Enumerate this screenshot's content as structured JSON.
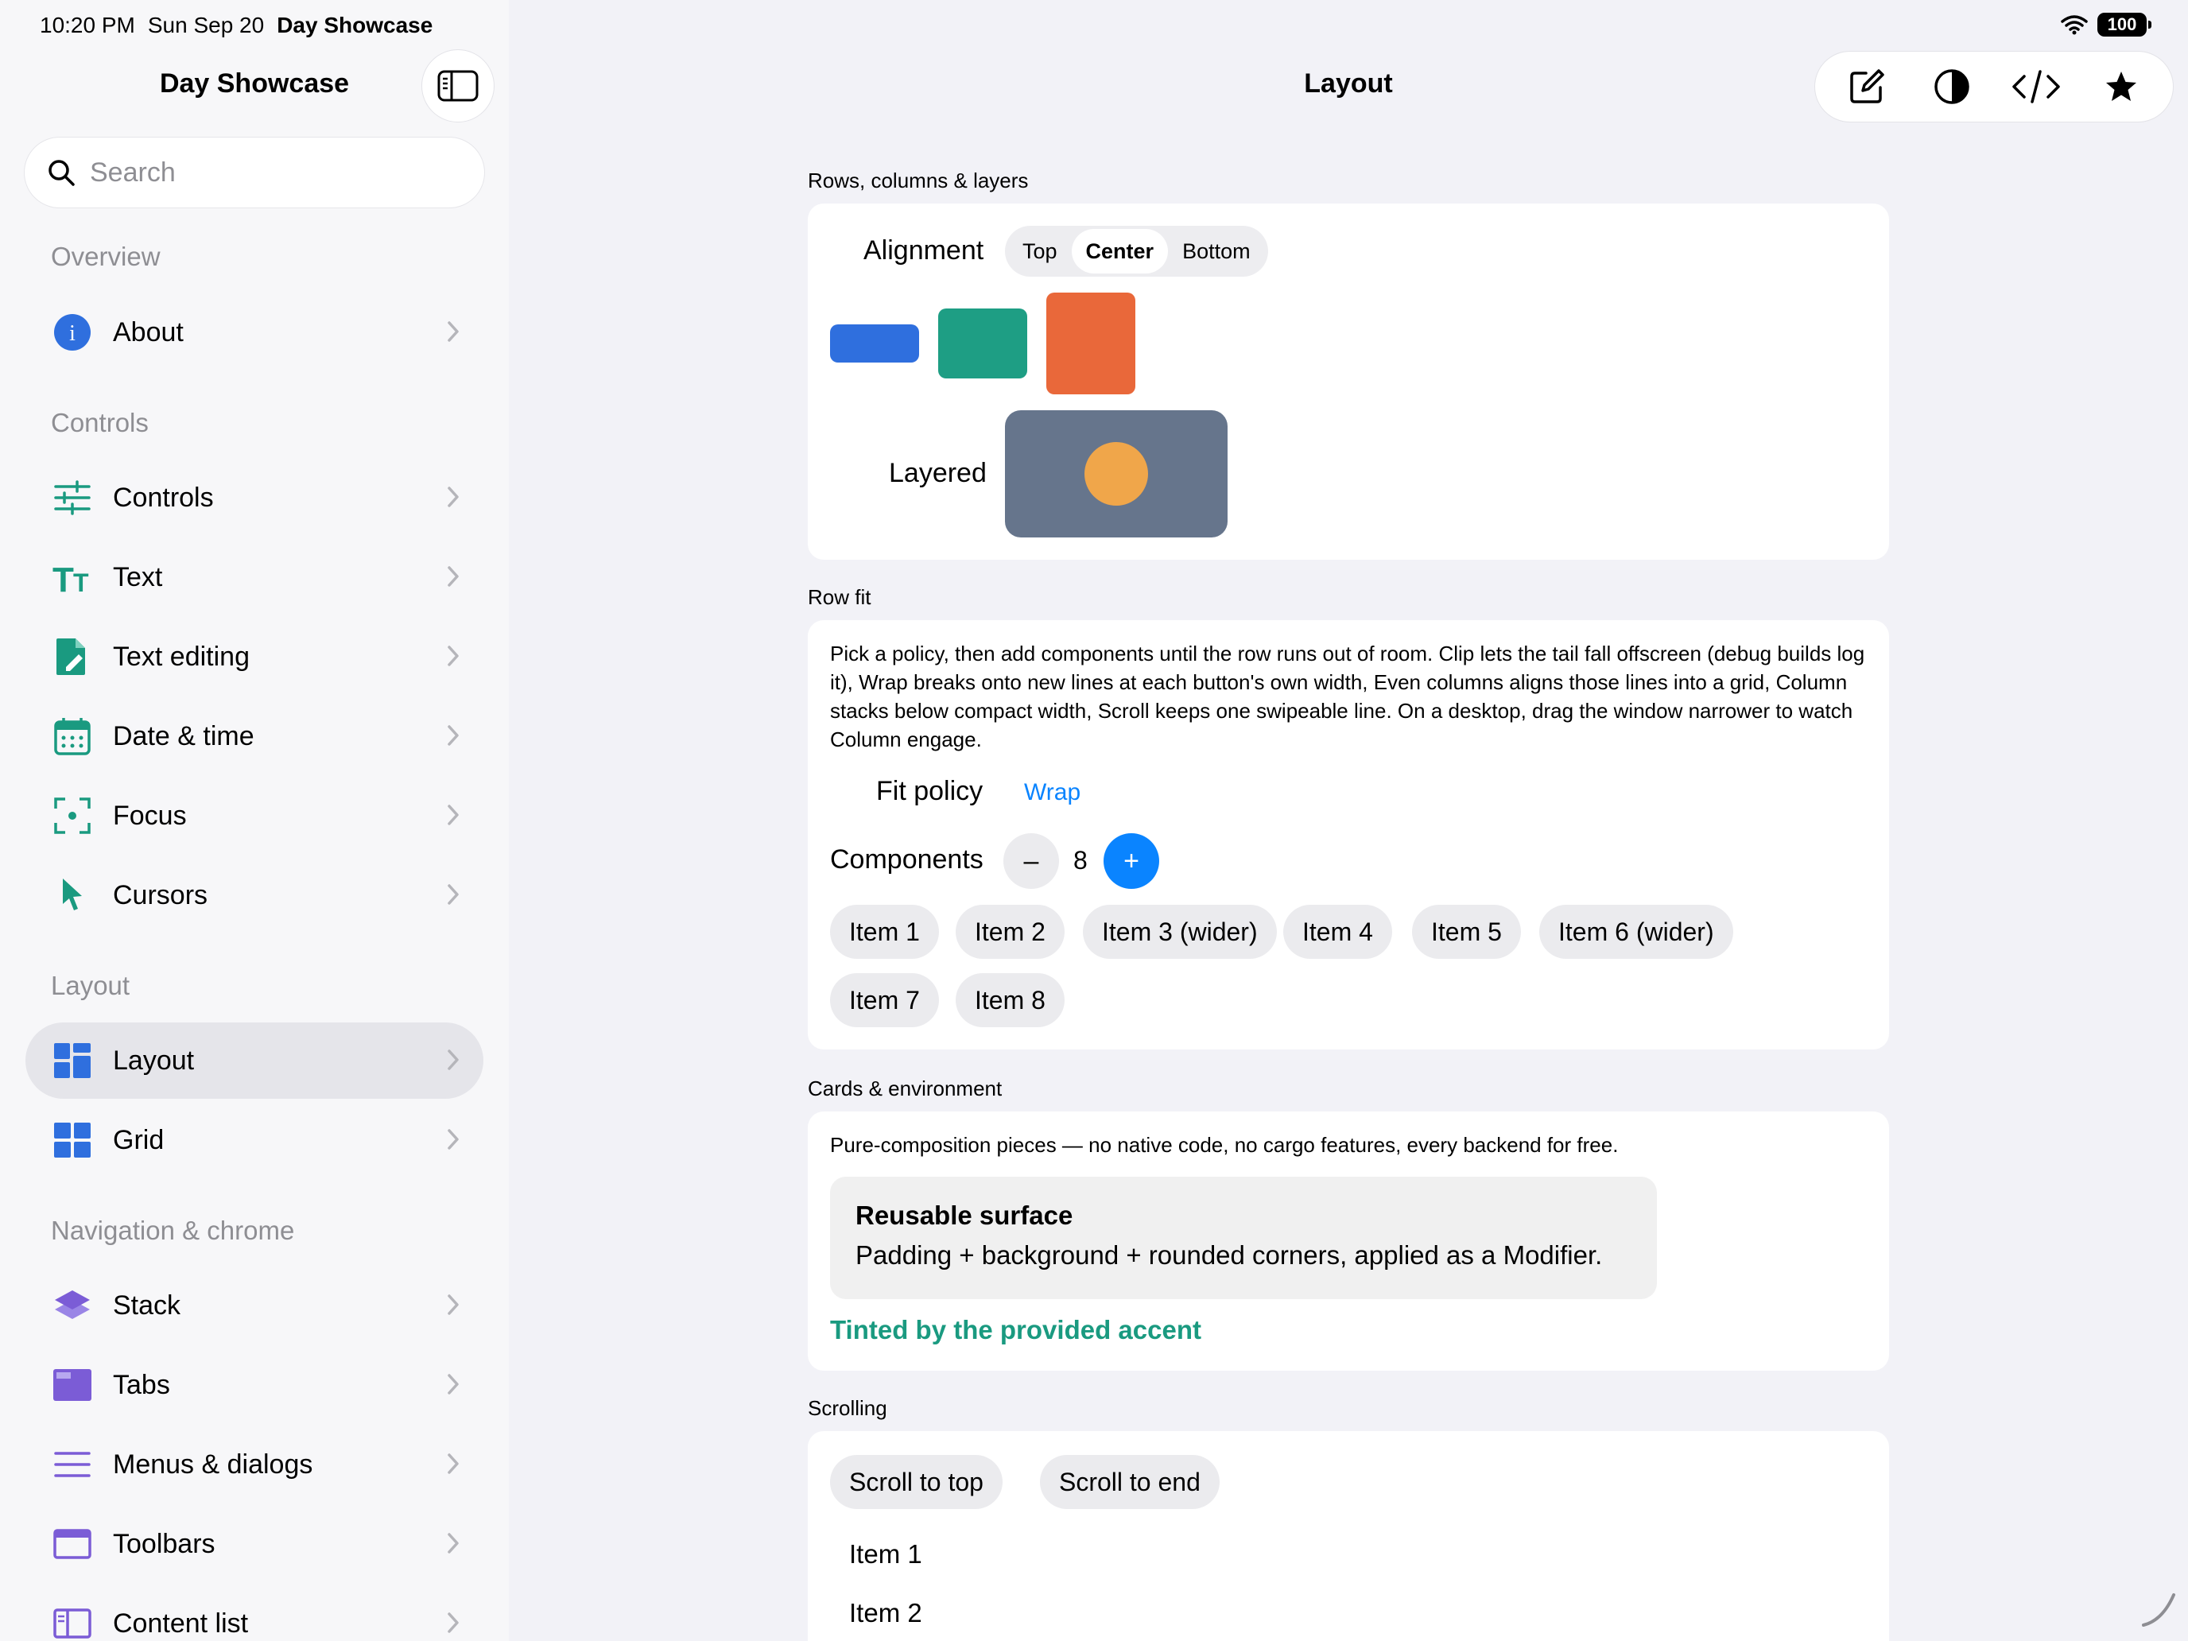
{
  "status": {
    "time": "10:20 PM",
    "date": "Sun Sep 20",
    "app_name": "Day Showcase",
    "battery": "100"
  },
  "sidebar": {
    "title": "Day Showcase",
    "search_placeholder": "Search",
    "sections": {
      "overview": "Overview",
      "controls": "Controls",
      "layout": "Layout",
      "navigation": "Navigation & chrome"
    },
    "items": {
      "about": "About",
      "controls": "Controls",
      "text": "Text",
      "text_editing": "Text editing",
      "date_time": "Date & time",
      "focus": "Focus",
      "cursors": "Cursors",
      "layout": "Layout",
      "grid": "Grid",
      "stack": "Stack",
      "tabs": "Tabs",
      "menus_dialogs": "Menus & dialogs",
      "toolbars": "Toolbars",
      "content_list": "Content list"
    },
    "selected": "layout",
    "colors": {
      "teal": "#1a9a80",
      "blue": "#2f6fde",
      "purple": "#7b5cd6"
    }
  },
  "main": {
    "title": "Layout",
    "toolbar_icons": [
      "compose-icon",
      "contrast-icon",
      "code-icon",
      "star-icon"
    ],
    "rows": {
      "section_title": "Rows, columns & layers",
      "alignment_label": "Alignment",
      "alignment_options": [
        "Top",
        "Center",
        "Bottom"
      ],
      "alignment_selected": "Center",
      "layered_label": "Layered",
      "colors": {
        "blue": "#2f6fde",
        "green": "#1e9e84",
        "orange": "#e9683a",
        "slate": "#66758c",
        "circle": "#f0a64a"
      }
    },
    "row_fit": {
      "section_title": "Row fit",
      "description": "Pick a policy, then add components until the row runs out of room. Clip lets the tail fall offscreen (debug builds log it), Wrap breaks onto new lines at each button's own width, Even columns aligns those lines into a grid, Column stacks below compact width, Scroll keeps one swipeable line. On a desktop, drag the window narrower to watch Column engage.",
      "fit_policy_label": "Fit policy",
      "fit_policy_value": "Wrap",
      "components_label": "Components",
      "components_count": "8",
      "minus": "–",
      "plus": "+",
      "items": [
        "Item 1",
        "Item 2",
        "Item 3 (wider)",
        "Item 4",
        "Item 5",
        "Item 6 (wider)",
        "Item 7",
        "Item 8"
      ],
      "accent_color": "#0a84ff"
    },
    "cards": {
      "section_title": "Cards & environment",
      "description": "Pure-composition pieces — no native code, no cargo features, every backend for free.",
      "surface_title": "Reusable surface",
      "surface_body": "Padding + background + rounded corners, applied as a Modifier.",
      "tinted": "Tinted by the provided accent",
      "accent_color": "#1a9a80"
    },
    "scrolling": {
      "section_title": "Scrolling",
      "buttons": [
        "Scroll to top",
        "Scroll to end"
      ],
      "rows": [
        "Item 1",
        "Item 2"
      ]
    }
  }
}
